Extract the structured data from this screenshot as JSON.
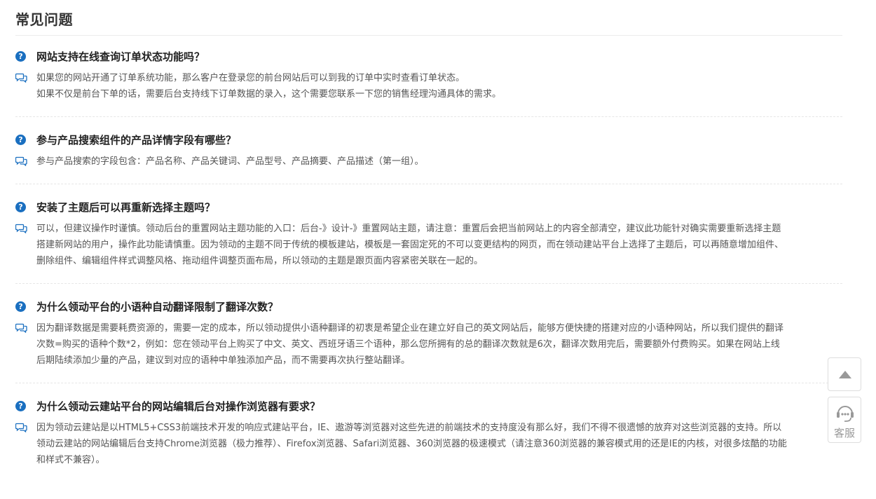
{
  "page": {
    "title": "常见问题"
  },
  "faq": [
    {
      "question": "网站支持在线查询订单状态功能吗？",
      "answer": [
        "如果您的网站开通了订单系统功能，那么客户在登录您的前台网站后可以到我的订单中实时查看订单状态。",
        "如果不仅是前台下单的话，需要后台支持线下订单数据的录入，这个需要您联系一下您的销售经理沟通具体的需求。"
      ]
    },
    {
      "question": "参与产品搜索组件的产品详情字段有哪些？",
      "answer": [
        "参与产品搜索的字段包含：产品名称、产品关键词、产品型号、产品摘要、产品描述（第一组）。"
      ]
    },
    {
      "question": "安装了主题后可以再重新选择主题吗？",
      "answer": [
        "可以，但建议操作时谨慎。领动后台的重置网站主题功能的入口：后台-》设计-》重置网站主题，请注意：重置后会把当前网站上的内容全部清空，建议此功能针对确实需要重新选择主题",
        "搭建新网站的用户，操作此功能请慎重。因为领动的主题不同于传统的模板建站，模板是一套固定死的不可以变更结构的网页，而在领动建站平台上选择了主题后，可以再随意增加组件、",
        "删除组件、编辑组件样式调整风格、拖动组件调整页面布局，所以领动的主题是跟页面内容紧密关联在一起的。"
      ]
    },
    {
      "question": "为什么领动平台的小语种自动翻译限制了翻译次数？",
      "answer": [
        "因为翻译数据是需要耗费资源的，需要一定的成本，所以领动提供小语种翻译的初衷是希望企业在建立好自己的英文网站后，能够方便快捷的搭建对应的小语种网站，所以我们提供的翻译",
        "次数=购买的语种个数*2，例如：您在领动平台上购买了中文、英文、西班牙语三个语种，那么您所拥有的总的翻译次数就是6次，翻译次数用完后，需要额外付费购买。如果在网站上线",
        "后期陆续添加少量的产品，建议到对应的语种中单独添加产品，而不需要再次执行整站翻译。"
      ]
    },
    {
      "question": "为什么领动云建站平台的网站编辑后台对操作浏览器有要求？",
      "answer": [
        "因为领动云建站是以HTML5+CSS3前端技术开发的响应式建站平台，IE、遨游等浏览器对这些先进的前端技术的支持度没有那么好，我们不得不很遗憾的放弃对这些浏览器的支持。所以",
        "领动云建站的网站编辑后台支持Chrome浏览器（极力推荐）、Firefox浏览器、Safari浏览器、360浏览器的极速模式（请注意360浏览器的兼容模式用的还是IE的内核，对很多炫酷的功能",
        "和样式不兼容）。"
      ]
    }
  ],
  "icons": {
    "question": "question-circle-icon",
    "answer": "speech-bubbles-icon",
    "back_to_top": "triangle-up-icon",
    "customer_service": "headset-chat-icon"
  },
  "float_bar": {
    "customer_service_label": "客服"
  },
  "colors": {
    "question_icon": "#1a6fc0",
    "answer_icon": "#1a6fc0",
    "title_text": "#333333",
    "body_text": "#555555"
  }
}
